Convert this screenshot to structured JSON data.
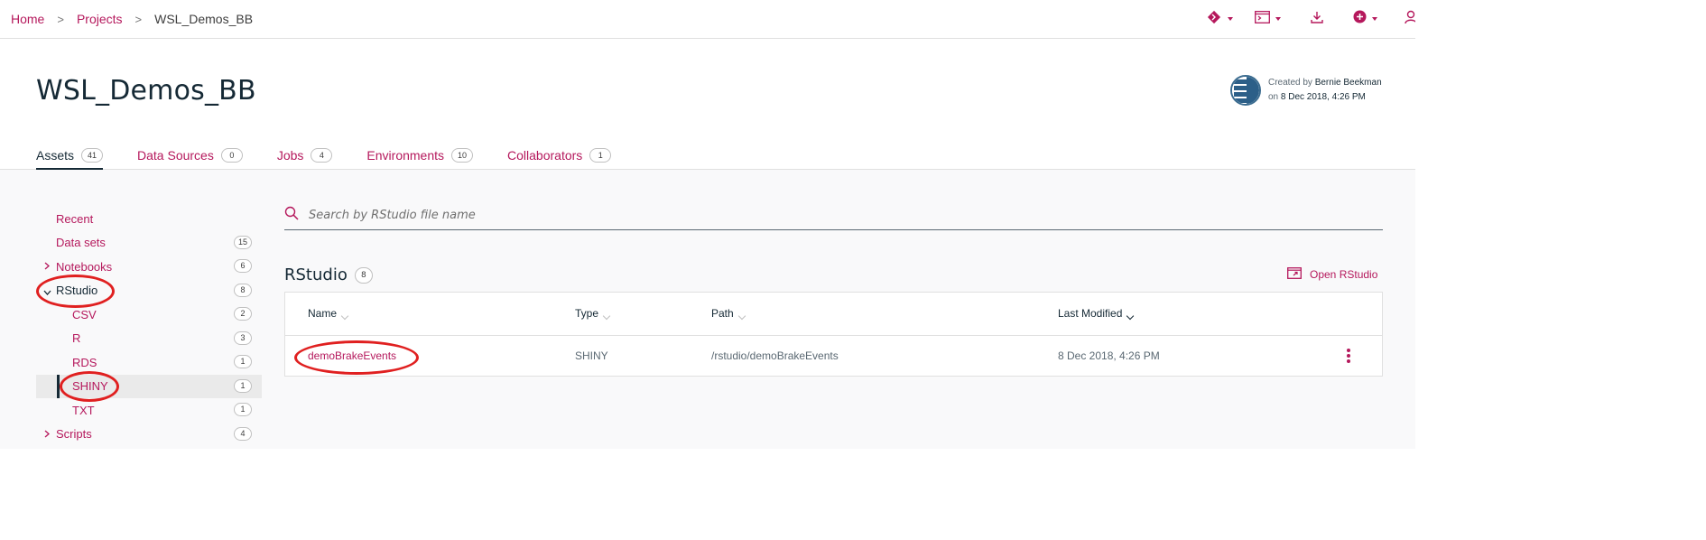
{
  "breadcrumb": {
    "home": "Home",
    "projects": "Projects",
    "current": "WSL_Demos_BB",
    "separator": ">"
  },
  "toolbar": {
    "icons": [
      "git-icon",
      "terminal-icon",
      "download-icon",
      "add-icon",
      "user-icon"
    ]
  },
  "project": {
    "title": "WSL_Demos_BB",
    "created_by_label": "Created by",
    "created_by": "Bernie Beekman",
    "created_on_label": "on",
    "created_on": "8 Dec 2018, 4:26 PM"
  },
  "tabs": [
    {
      "label": "Assets",
      "count": "41",
      "active": true
    },
    {
      "label": "Data Sources",
      "count": "0"
    },
    {
      "label": "Jobs",
      "count": "4"
    },
    {
      "label": "Environments",
      "count": "10"
    },
    {
      "label": "Collaborators",
      "count": "1"
    }
  ],
  "sidebar": {
    "items": [
      {
        "label": "Recent",
        "count": ""
      },
      {
        "label": "Data sets",
        "count": "15"
      },
      {
        "label": "Notebooks",
        "count": "6",
        "chevron": ">"
      },
      {
        "label": "RStudio",
        "count": "8",
        "chevron": "v"
      },
      {
        "label": "CSV",
        "count": "2"
      },
      {
        "label": "R",
        "count": "3"
      },
      {
        "label": "RDS",
        "count": "1"
      },
      {
        "label": "SHINY",
        "count": "1"
      },
      {
        "label": "TXT",
        "count": "1"
      },
      {
        "label": "Scripts",
        "count": "4",
        "chevron": ">"
      }
    ]
  },
  "search": {
    "placeholder": "Search by RStudio file name"
  },
  "section": {
    "title": "RStudio",
    "count": "8",
    "open_label": "Open RStudio"
  },
  "table": {
    "headers": [
      "Name",
      "Type",
      "Path",
      "Last Modified"
    ],
    "rows": [
      {
        "name": "demoBrakeEvents",
        "type": "SHINY",
        "path": "/rstudio/demoBrakeEvents",
        "modified": "8 Dec 2018, 4:26 PM"
      }
    ]
  },
  "colors": {
    "accent": "#b5185c",
    "text": "#152935",
    "annotation": "#e02020"
  }
}
